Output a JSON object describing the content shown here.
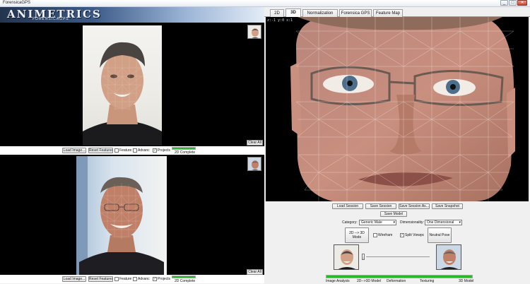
{
  "window": {
    "title": "ForensicaGPS",
    "minimize": "_",
    "maximize": "□",
    "close": "✕"
  },
  "logo": {
    "brand": "ANIMETRICS",
    "sub": "FORENSICAGPS"
  },
  "left": {
    "top_viewer": {
      "clear_label": "Clear All",
      "load_label": "Load Image...",
      "reset_label": "Reset Features",
      "feature_label": "Feature",
      "feature_checked": false,
      "advanced_label": "Advanc",
      "advanced_checked": false,
      "projects_label": "Projects",
      "projects_checked": true,
      "progress_label": "2D Complete",
      "progress": 1.0
    },
    "bottom_viewer": {
      "clear_label": "Clear All",
      "load_label": "Load Image...",
      "reset_label": "Reset Features",
      "feature_label": "Feature",
      "feature_checked": false,
      "advanced_label": "Advanc",
      "advanced_checked": false,
      "projects_label": "Projects",
      "projects_checked": true,
      "progress_label": "2D Complete",
      "progress": 1.0
    }
  },
  "tabs": [
    {
      "label": "2D",
      "active": false
    },
    {
      "label": "3D",
      "active": true
    },
    {
      "label": "Normalization",
      "active": false
    },
    {
      "label": "Forensica GPS",
      "active": false
    },
    {
      "label": "Feature Map",
      "active": false
    }
  ],
  "view3d": {
    "coords": "z:-1  y:0  x:1"
  },
  "controls": {
    "load_session": "Load Session",
    "save_session": "Save Session",
    "save_session_as": "Save Session As...",
    "save_snapshot": "Save Snapshot",
    "save_model": "Save Model",
    "category_label": "Category:",
    "category_value": "Generic Male",
    "dimensionality_label": "Dimensionality:",
    "dimensionality_value": "One Dimensional",
    "mode_button": "2D --> 3D Mode",
    "wireframe_label": "Wirefram",
    "wireframe_checked": false,
    "split_label": "Split Viewpc",
    "split_checked": true,
    "neutral_button": "Neutral Pose"
  },
  "stages": {
    "progress": 1.0,
    "labels": [
      "Image Analysis",
      "2D-->3D Model",
      "Deformation",
      "Texturing",
      "3D Model"
    ]
  },
  "colors": {
    "progress_green": "#2db52d",
    "viewer_bg": "#000000"
  },
  "icons": [
    "portrait-thumbnail",
    "checkbox",
    "dropdown-arrow"
  ]
}
